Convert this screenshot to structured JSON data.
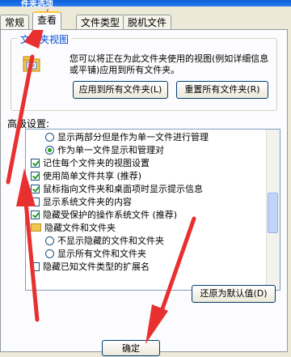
{
  "window": {
    "title": "件夹选项"
  },
  "tabs": [
    {
      "label": "常规"
    },
    {
      "label": "查看"
    },
    {
      "label": "文件类型"
    },
    {
      "label": "脱机文件"
    }
  ],
  "folder_views": {
    "legend": "文件夹视图",
    "description": "您可以将正在为此文件夹使用的视图(例如详细信息或平铺)应用到所有文件夹。",
    "apply_button": "应用到所有文件夹(L)",
    "reset_button": "重置所有文件夹(R)"
  },
  "advanced": {
    "label": "高级设置:",
    "items": [
      {
        "type": "radio",
        "checked": false,
        "label": "显示两部分但是作为单一文件进行管理"
      },
      {
        "type": "radio",
        "checked": true,
        "label": "作为单一文件显示和管理对"
      },
      {
        "type": "checkbox",
        "checked": true,
        "label": "记住每个文件夹的视图设置"
      },
      {
        "type": "checkbox",
        "checked": true,
        "label": "使用简单文件共享 (推荐)"
      },
      {
        "type": "checkbox",
        "checked": true,
        "label": "鼠标指向文件夹和桌面项时显示提示信息"
      },
      {
        "type": "checkbox",
        "checked": false,
        "label": "显示系统文件夹的内容"
      },
      {
        "type": "checkbox",
        "checked": true,
        "label": "隐藏受保护的操作系统文件 (推荐)"
      },
      {
        "type": "folder",
        "label": "隐藏文件和文件夹"
      },
      {
        "type": "radio",
        "checked": false,
        "label": "不显示隐藏的文件和文件夹"
      },
      {
        "type": "radio",
        "checked": false,
        "label": "显示所有文件和文件夹"
      },
      {
        "type": "checkbox",
        "checked": false,
        "label": "隐藏已知文件类型的扩展名"
      }
    ],
    "restore_button": "还原为默认值(D)"
  },
  "footer": {
    "ok_button": "确定"
  },
  "colors": {
    "annotation_arrow": "#e83030",
    "tab_highlight": "#ffc83c",
    "check_mark": "#21a121"
  }
}
